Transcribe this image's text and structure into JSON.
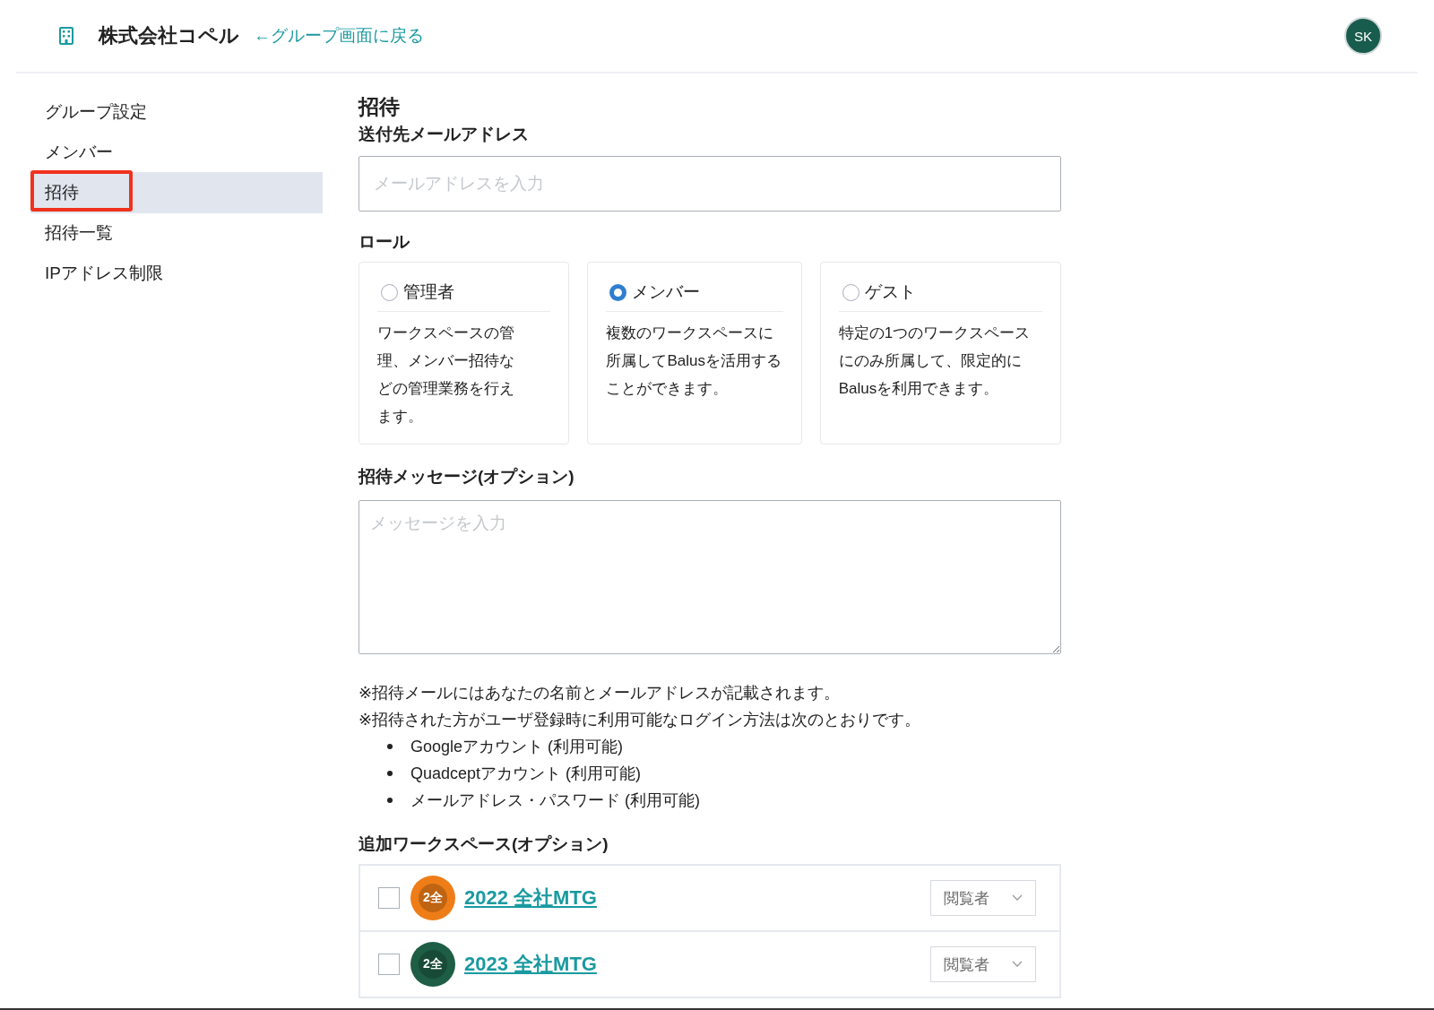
{
  "header": {
    "org_name": "株式会社コペル",
    "back_link": "←グループ画面に戻る",
    "avatar": "SK"
  },
  "sidebar": {
    "items": [
      {
        "label": "グループ設定",
        "selected": false,
        "annotated": false
      },
      {
        "label": "メンバー",
        "selected": false,
        "annotated": false
      },
      {
        "label": "招待",
        "selected": true,
        "annotated": true
      },
      {
        "label": "招待一覧",
        "selected": false,
        "annotated": false
      },
      {
        "label": "IPアドレス制限",
        "selected": false,
        "annotated": false
      }
    ]
  },
  "page_title": "招待",
  "email": {
    "label": "送付先メールアドレス",
    "placeholder": "メールアドレスを入力"
  },
  "role": {
    "label": "ロール",
    "options": [
      {
        "name": "管理者",
        "selected": false,
        "description": "ワークスペースの管理、メンバー招待などの管理業務を行えます。"
      },
      {
        "name": "メンバー",
        "selected": true,
        "description": "複数のワークスペースに所属してBalusを活用することができます。"
      },
      {
        "name": "ゲスト",
        "selected": false,
        "description": "特定の1つのワークスペースにのみ所属して、限定的にBalusを利用できます。"
      }
    ]
  },
  "message": {
    "label": "招待メッセージ(オプション)",
    "placeholder": "メッセージを入力"
  },
  "notes": [
    "※招待メールにはあなたの名前とメールアドレスが記載されます。",
    "※招待された方がユーザ登録時に利用可能なログイン方法は次のとおりです。"
  ],
  "login_methods": [
    "Googleアカウント (利用可能)",
    "Quadceptアカウント (利用可能)",
    "メールアドレス・パスワード (利用可能)"
  ],
  "workspaces": {
    "label": "追加ワークスペース(オプション)",
    "items": [
      {
        "checked": false,
        "badge": "2全",
        "color": "#ef7d17",
        "name": "2022 全社MTG",
        "role": "閲覧者"
      },
      {
        "checked": false,
        "badge": "2全",
        "color": "#1d5e45",
        "name": "2023 全社MTG",
        "role": "閲覧者"
      }
    ]
  }
}
